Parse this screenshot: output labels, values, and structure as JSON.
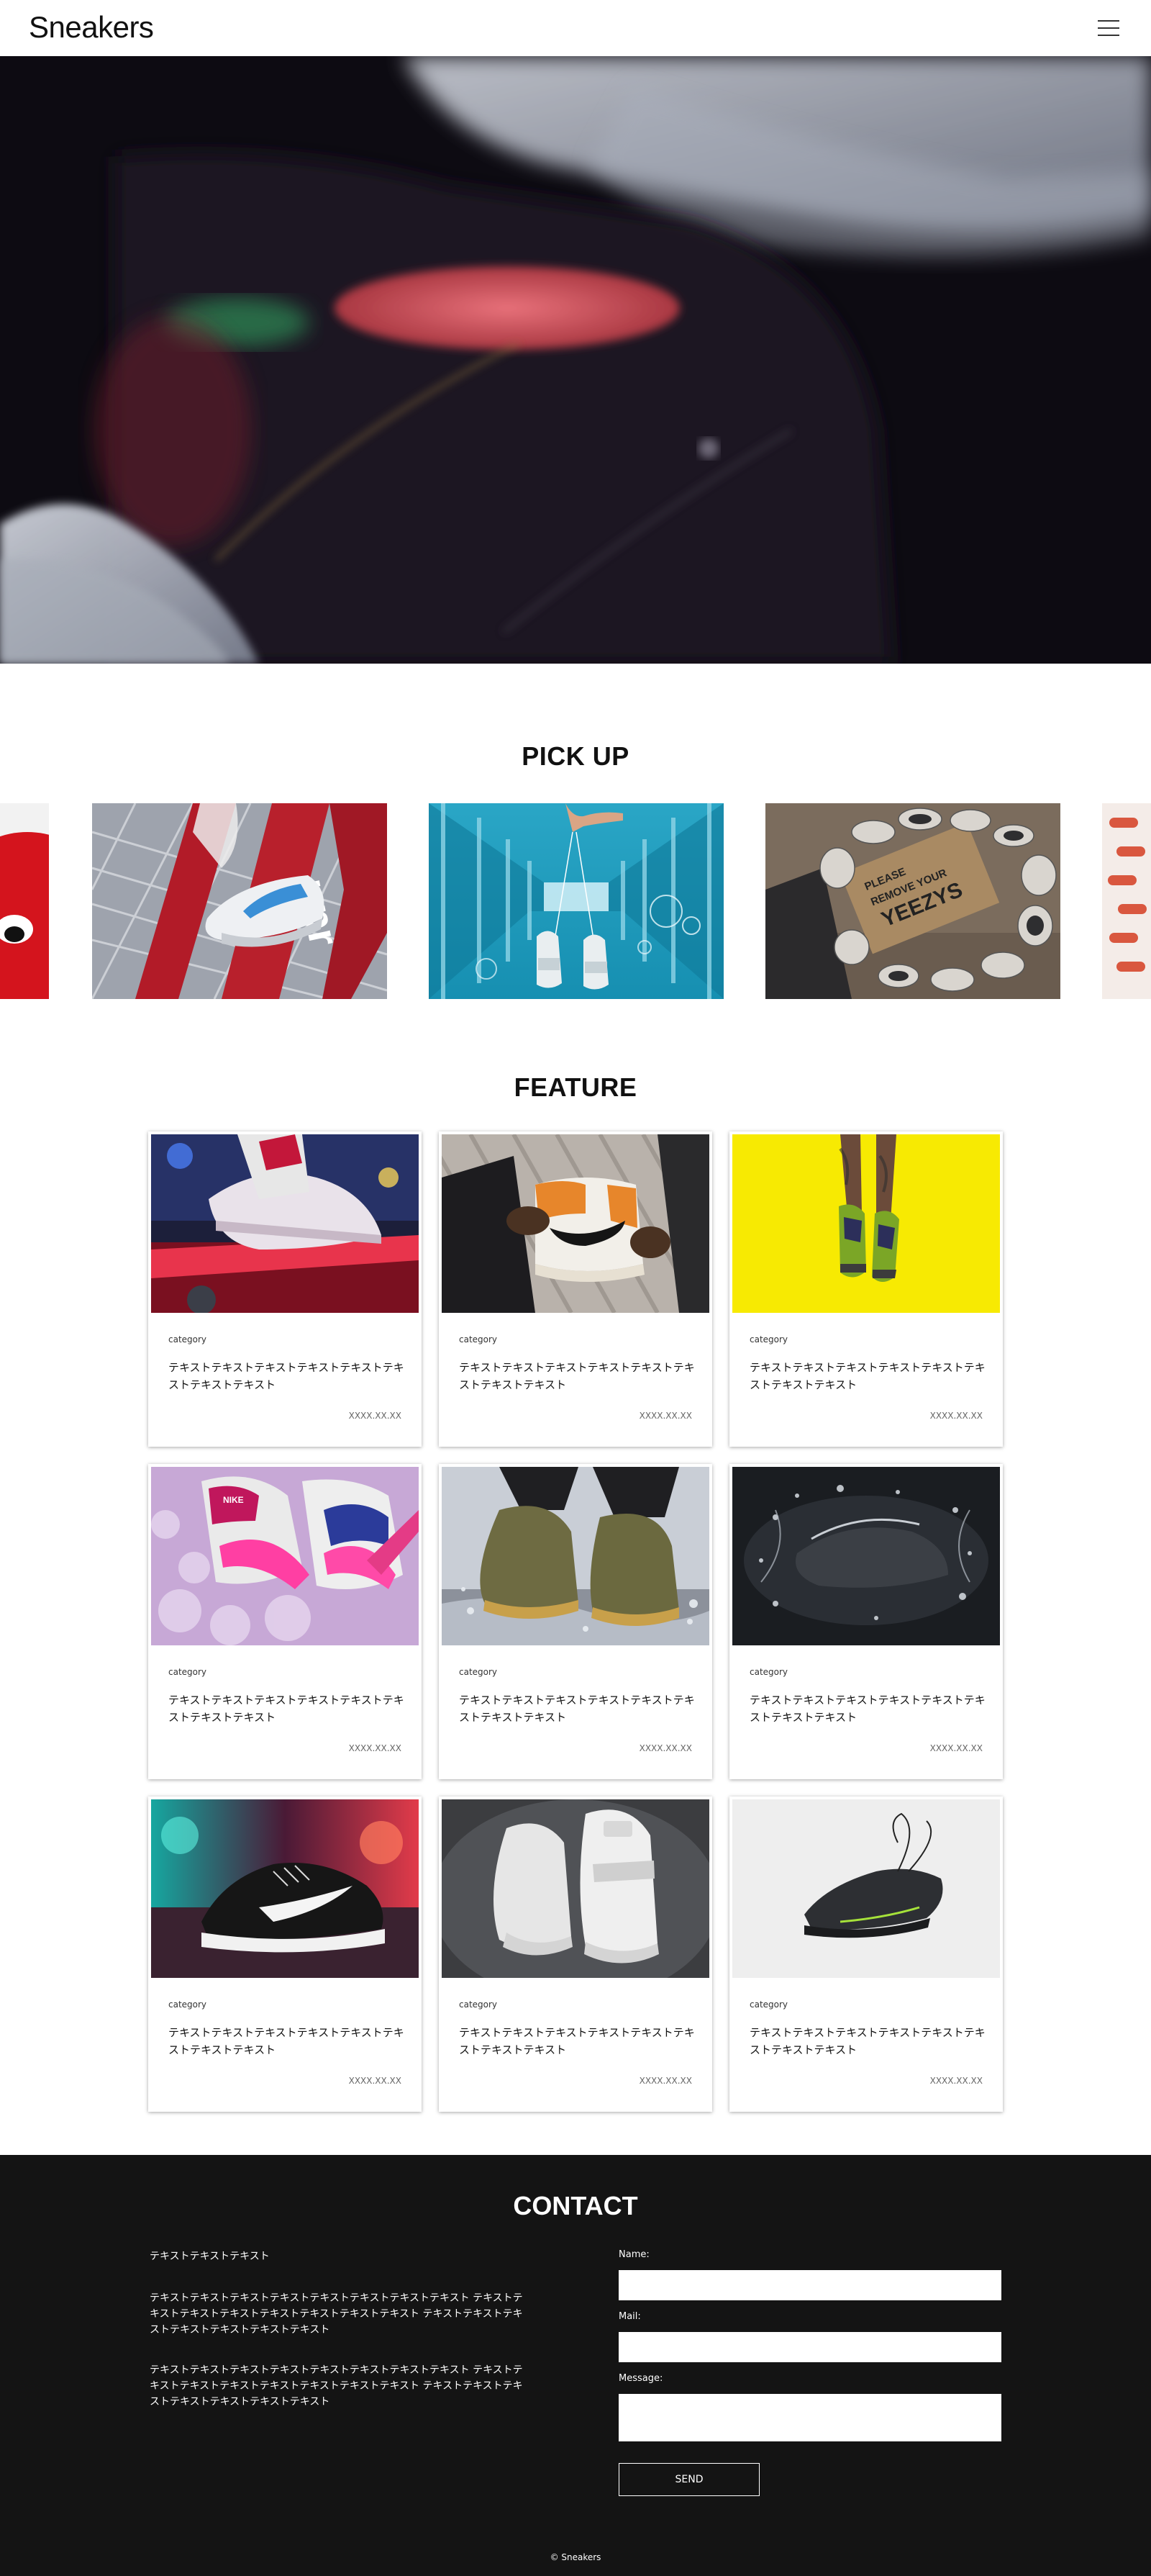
{
  "header": {
    "logo": "Sneakers",
    "menu_icon": "hamburger-menu-icon"
  },
  "hero": {
    "image": "sneaker-closeup-photo"
  },
  "pickup": {
    "title": "PICK UP",
    "items": [
      {
        "image": "red-character-photo"
      },
      {
        "image": "sneaker-on-red-bars-photo"
      },
      {
        "image": "sneakers-hanging-bridge-photo"
      },
      {
        "image": "sneakers-circle-doormat-photo",
        "doormat_text": "PLEASE REMOVE YOUR YEEZYS"
      },
      {
        "image": "partial-photo"
      }
    ]
  },
  "feature": {
    "title": "FEATURE",
    "cards": [
      {
        "category": "category",
        "title": "テキストテキストテキストテキストテキストテキストテキストテキスト",
        "date": "XXXX.XX.XX"
      },
      {
        "category": "category",
        "title": "テキストテキストテキストテキストテキストテキストテキストテキスト",
        "date": "XXXX.XX.XX"
      },
      {
        "category": "category",
        "title": "テキストテキストテキストテキストテキストテキストテキストテキスト",
        "date": "XXXX.XX.XX"
      },
      {
        "category": "category",
        "title": "テキストテキストテキストテキストテキストテキストテキストテキスト",
        "date": "XXXX.XX.XX"
      },
      {
        "category": "category",
        "title": "テキストテキストテキストテキストテキストテキストテキストテキスト",
        "date": "XXXX.XX.XX"
      },
      {
        "category": "category",
        "title": "テキストテキストテキストテキストテキストテキストテキストテキスト",
        "date": "XXXX.XX.XX"
      },
      {
        "category": "category",
        "title": "テキストテキストテキストテキストテキストテキストテキストテキスト",
        "date": "XXXX.XX.XX"
      },
      {
        "category": "category",
        "title": "テキストテキストテキストテキストテキストテキストテキストテキスト",
        "date": "XXXX.XX.XX"
      },
      {
        "category": "category",
        "title": "テキストテキストテキストテキストテキストテキストテキストテキスト",
        "date": "XXXX.XX.XX"
      }
    ]
  },
  "contact": {
    "title": "CONTACT",
    "intro": "テキストテキストテキスト",
    "paragraph1": "テキストテキストテキストテキストテキストテキストテキストテキスト テキストテキストテキストテキストテキストテキストテキストテキスト テキストテキストテキストテキストテキストテキストテキスト",
    "paragraph2": "テキストテキストテキストテキストテキストテキストテキストテキスト テキストテキストテキストテキストテキストテキストテキストテキスト テキストテキストテキストテキストテキストテキストテキスト",
    "name_label": "Name:",
    "mail_label": "Mail:",
    "message_label": "Message:",
    "send_label": "SEND"
  },
  "footer": {
    "copyright": "© Sneakers"
  }
}
